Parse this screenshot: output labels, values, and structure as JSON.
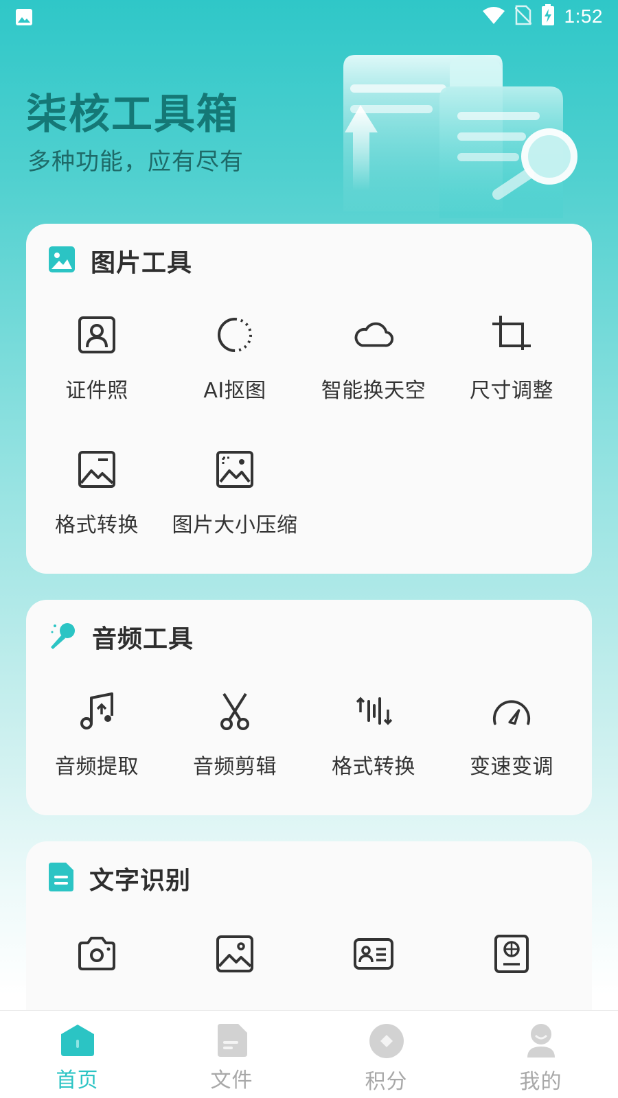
{
  "status_bar": {
    "time": "1:52"
  },
  "hero": {
    "title": "柒核工具箱",
    "subtitle": "多种功能，应有尽有"
  },
  "sections": {
    "image_tools": {
      "title": "图片工具",
      "items": [
        {
          "label": "证件照",
          "icon": "id-photo-icon"
        },
        {
          "label": "AI抠图",
          "icon": "ai-cutout-icon"
        },
        {
          "label": "智能换天空",
          "icon": "cloud-icon"
        },
        {
          "label": "尺寸调整",
          "icon": "crop-icon"
        },
        {
          "label": "格式转换",
          "icon": "image-format-icon"
        },
        {
          "label": "图片大小压缩",
          "icon": "image-compress-icon"
        }
      ]
    },
    "audio_tools": {
      "title": "音频工具",
      "items": [
        {
          "label": "音频提取",
          "icon": "music-extract-icon"
        },
        {
          "label": "音频剪辑",
          "icon": "scissors-icon"
        },
        {
          "label": "格式转换",
          "icon": "audio-format-icon"
        },
        {
          "label": "变速变调",
          "icon": "speedometer-icon"
        }
      ]
    },
    "text_recognition": {
      "title": "文字识别",
      "items": [
        {
          "icon": "camera-icon"
        },
        {
          "icon": "picture-icon"
        },
        {
          "icon": "id-card-icon"
        },
        {
          "icon": "passport-icon"
        }
      ]
    }
  },
  "bottom_nav": {
    "active": "home",
    "items": [
      {
        "label": "首页",
        "icon": "home-icon"
      },
      {
        "label": "文件",
        "icon": "file-icon"
      },
      {
        "label": "积分",
        "icon": "points-icon"
      },
      {
        "label": "我的",
        "icon": "profile-icon"
      }
    ]
  },
  "colors": {
    "accent": "#2bc4c4",
    "title": "#157876",
    "nav_inactive": "#a8a8a8",
    "card_bg": "#fafafa"
  }
}
